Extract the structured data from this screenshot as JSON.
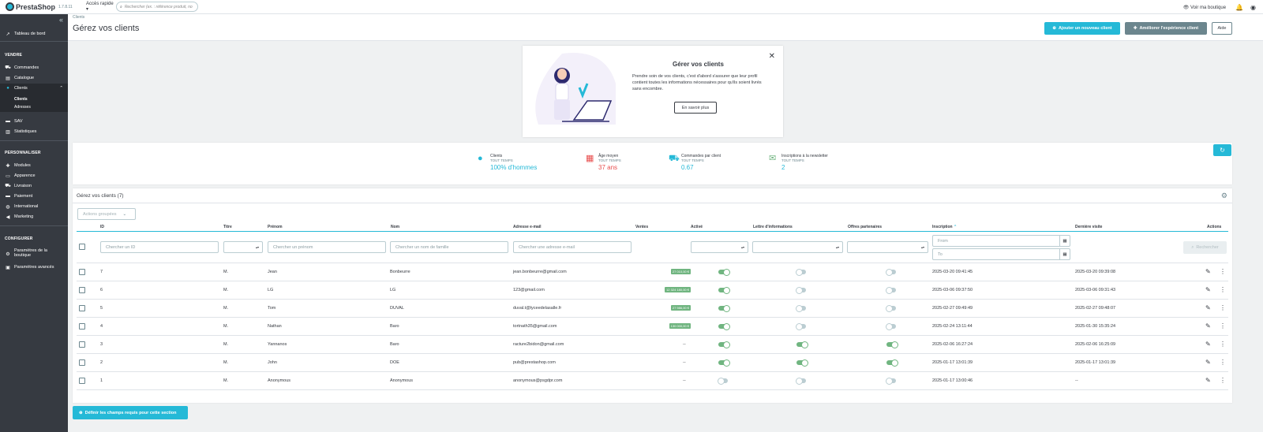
{
  "topbar": {
    "brand": "PrestaShop",
    "version": "1.7.8.11",
    "quick_access": "Accès rapide",
    "search_placeholder": "Rechercher (ex. : référence produit, no",
    "view_shop": "Voir ma boutique"
  },
  "sidebar": {
    "dashboard": "Tableau de bord",
    "section_sell": "VENDRE",
    "orders": "Commandes",
    "catalog": "Catalogue",
    "customers": "Clients",
    "sub_customers": "Clients",
    "sub_addresses": "Adresses",
    "sav": "SAV",
    "stats": "Statistiques",
    "section_personalize": "PERSONNALISER",
    "modules": "Modules",
    "appearance": "Apparence",
    "shipping": "Livraison",
    "payment": "Paiement",
    "international": "International",
    "marketing": "Marketing",
    "section_configure": "CONFIGURER",
    "shop_params_1": "Paramètres de la",
    "shop_params_2": "boutique",
    "advanced_params": "Paramètres avancés"
  },
  "header": {
    "breadcrumb": "Clients",
    "title": "Gérez vos clients",
    "add_button": "Ajouter un nouveau client",
    "improve_button": "Améliorer l'expérience client",
    "help_button": "Aide"
  },
  "helpcard": {
    "title": "Gérer vos clients",
    "text": "Prendre soin de vos clients, c'est d'abord s'assurer que leur profil contient toutes les informations nécessaires pour qu'ils soient livrés sans encombre.",
    "button": "En savoir plus"
  },
  "kpis": [
    {
      "label": "Clients",
      "period": "TOUT TEMPS",
      "value": "100% d'hommes",
      "color": "#25b9d7"
    },
    {
      "label": "Âge moyen",
      "period": "TOUT TEMPS",
      "value": "37 ans",
      "color": "#e84e4e"
    },
    {
      "label": "Commandes par client",
      "period": "TOUT TEMPS",
      "value": "0.67",
      "color": "#25b9d7"
    },
    {
      "label": "Inscriptions à la newsletter",
      "period": "TOUT TEMPS",
      "value": "2",
      "color": "#25b9d7"
    }
  ],
  "panel": {
    "title": "Gérez vos clients (7)",
    "bulk_actions": "Actions groupées",
    "columns": {
      "id": "ID",
      "title": "Titre",
      "firstname": "Prénom",
      "lastname": "Nom",
      "email": "Adresse e-mail",
      "sales": "Ventes",
      "active": "Activé",
      "newsletter": "Lettre d'informations",
      "partners": "Offres partenaires",
      "registration": "Inscription",
      "last_visit": "Dernière visite",
      "actions": "Actions"
    },
    "filters": {
      "id": "Chercher un ID",
      "firstname": "Chercher un prénom",
      "lastname": "Chercher un nom de famille",
      "email": "Chercher une adresse e-mail",
      "from": "From",
      "to": "To",
      "search_button": "Rechercher"
    },
    "rows": [
      {
        "id": "7",
        "title": "M.",
        "firstname": "Jean",
        "lastname": "Bonbeurre",
        "email": "jean.bonbeurre@gmail.com",
        "sales": "27 010,00 €",
        "active": true,
        "newsletter": false,
        "partners": false,
        "registration": "2025-03-20 09:41:45",
        "last_visit": "2025-03-20 09:39:08"
      },
      {
        "id": "6",
        "title": "M.",
        "firstname": "LG",
        "lastname": "LG",
        "email": "123@gmail.com",
        "sales": "12 324 180,00 €",
        "active": true,
        "newsletter": false,
        "partners": false,
        "registration": "2025-03-06 09:37:50",
        "last_visit": "2025-03-06 09:31:43"
      },
      {
        "id": "5",
        "title": "M.",
        "firstname": "Tom",
        "lastname": "DUVAL",
        "email": "duval.t@lyceedelasalle.fr",
        "sales": "27 986,00 €",
        "active": true,
        "newsletter": false,
        "partners": false,
        "registration": "2025-02-27 09:49:49",
        "last_visit": "2025-02-27 09:48:07"
      },
      {
        "id": "4",
        "title": "M.",
        "firstname": "Nathan",
        "lastname": "Baro",
        "email": "tortnath35@gmail.com",
        "sales": "130 000,00 €",
        "active": true,
        "newsletter": false,
        "partners": false,
        "registration": "2025-02-24 13:11:44",
        "last_visit": "2025-01-30 15:35:24"
      },
      {
        "id": "3",
        "title": "M.",
        "firstname": "Yannanos",
        "lastname": "Baro",
        "email": "racture2bidon@gmail.com",
        "sales": "--",
        "active": true,
        "newsletter": true,
        "partners": true,
        "registration": "2025-02-06 16:27:24",
        "last_visit": "2025-02-06 16:25:09"
      },
      {
        "id": "2",
        "title": "M.",
        "firstname": "John",
        "lastname": "DOE",
        "email": "pub@prestashop.com",
        "sales": "--",
        "active": true,
        "newsletter": true,
        "partners": true,
        "registration": "2025-01-17 13:01:39",
        "last_visit": "2025-01-17 13:01:39"
      },
      {
        "id": "1",
        "title": "M.",
        "firstname": "Anonymous",
        "lastname": "Anonymous",
        "email": "anonymous@psgdpr.com",
        "sales": "--",
        "active": false,
        "newsletter": false,
        "partners": false,
        "registration": "2025-01-17 13:00:46",
        "last_visit": "--"
      }
    ]
  },
  "footer": {
    "required_fields_button": "Définir les champs requis pour cette section"
  }
}
